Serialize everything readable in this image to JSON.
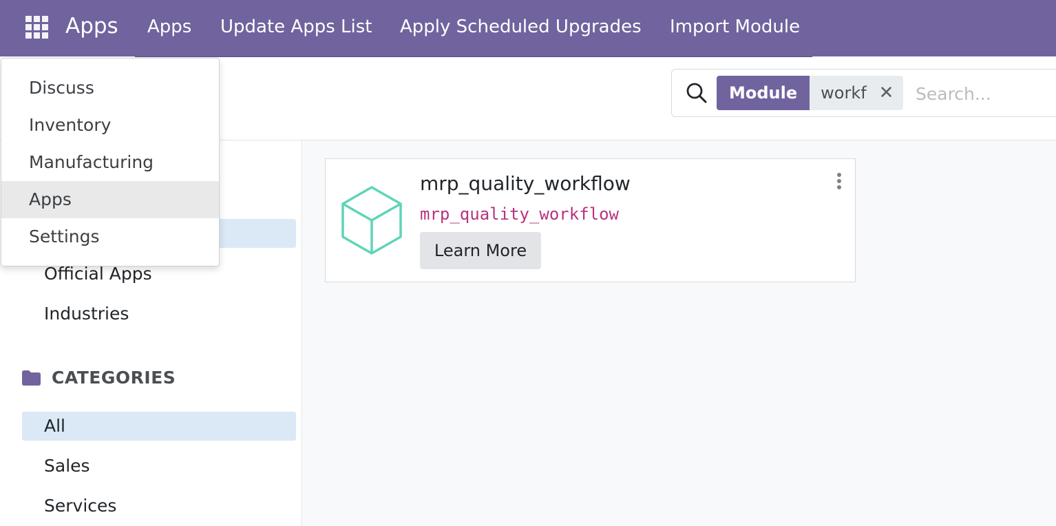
{
  "navbar": {
    "brand": "Apps",
    "menu_icon": "grid-icon",
    "items": [
      "Apps",
      "Update Apps List",
      "Apply Scheduled Upgrades",
      "Import Module"
    ]
  },
  "search": {
    "icon": "search-icon",
    "facet_label": "Module",
    "facet_value": "workf",
    "placeholder": "Search..."
  },
  "dropdown": {
    "items": [
      "Discuss",
      "Inventory",
      "Manufacturing",
      "Apps",
      "Settings"
    ],
    "highlighted": "Apps"
  },
  "sidebar": {
    "filters": [
      "Official Apps",
      "Industries"
    ],
    "categories_title": "CATEGORIES",
    "categories_icon": "folder-icon",
    "categories": [
      "All",
      "Sales",
      "Services"
    ],
    "active_category": "All"
  },
  "module_card": {
    "name": "mrp_quality_workflow",
    "technical_name": "mrp_quality_workflow",
    "button_label": "Learn More",
    "icon": "cube-icon"
  },
  "colors": {
    "brand": "#71639e",
    "technical_name": "#b83280",
    "cube": "#5fd4b8",
    "active_row": "#dbe9f6"
  }
}
